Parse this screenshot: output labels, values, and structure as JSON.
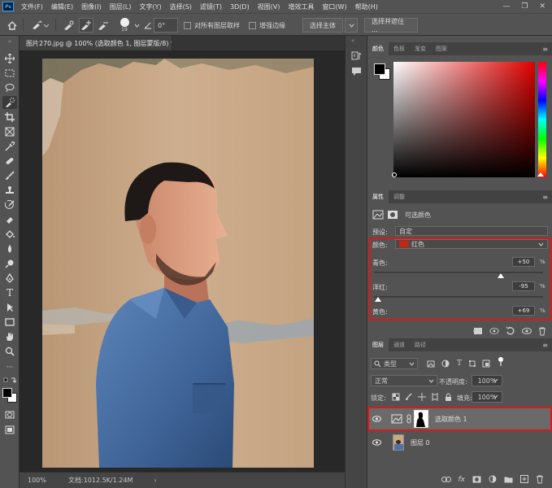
{
  "app": {
    "logo": "Ps"
  },
  "menu": [
    "文件(F)",
    "编辑(E)",
    "图像(I)",
    "图层(L)",
    "文字(Y)",
    "选择(S)",
    "滤镜(T)",
    "3D(D)",
    "视图(V)",
    "增效工具",
    "窗口(W)",
    "帮助(H)"
  ],
  "window_controls": {
    "minimize": "—",
    "restore": "❐",
    "close": "✕"
  },
  "options": {
    "brush_size": "19",
    "angle": "0°",
    "sample_all_layers": "对所有图层取样",
    "enhance_edge": "增强边缘",
    "select_subject": "选择主体",
    "select_and_mask": "选择并遮住 ..."
  },
  "document": {
    "tab_title": "图片270.jpg @ 100% (选取颜色 1, 图层蒙版/8) *",
    "zoom": "100%",
    "doc_info": "文档:1012.5K/1.24M"
  },
  "color_panel": {
    "tabs": [
      "颜色",
      "色板",
      "渐变",
      "图案"
    ],
    "active": 0,
    "hue_color": "#e00000"
  },
  "properties": {
    "tabs": [
      "属性",
      "调整"
    ],
    "active": 0,
    "adjustment_name": "可选颜色",
    "preset_label": "预设:",
    "preset_value": "自定",
    "colors_label": "颜色:",
    "colors_value": "红色",
    "colors_swatch": "#c8250e",
    "sliders": [
      {
        "label": "青色:",
        "value": "+50",
        "unit": "%",
        "level": 0.75
      },
      {
        "label": "洋红:",
        "value": "-95",
        "unit": "%",
        "level": 0.025
      },
      {
        "label": "黄色:",
        "value": "+69",
        "unit": "%",
        "level": 0.845
      }
    ]
  },
  "layers_panel": {
    "tabs": [
      "图层",
      "通道",
      "路径"
    ],
    "active": 0,
    "filter_kind": "类型",
    "blend_mode": "正常",
    "opacity_label": "不透明度:",
    "opacity_value": "100%",
    "lock_label": "锁定:",
    "fill_label": "填充:",
    "fill_value": "100%",
    "layers": [
      {
        "name": "选取颜色 1",
        "selected": true
      },
      {
        "name": "图层 0",
        "selected": false
      }
    ]
  },
  "highlight_color": "#e01616"
}
